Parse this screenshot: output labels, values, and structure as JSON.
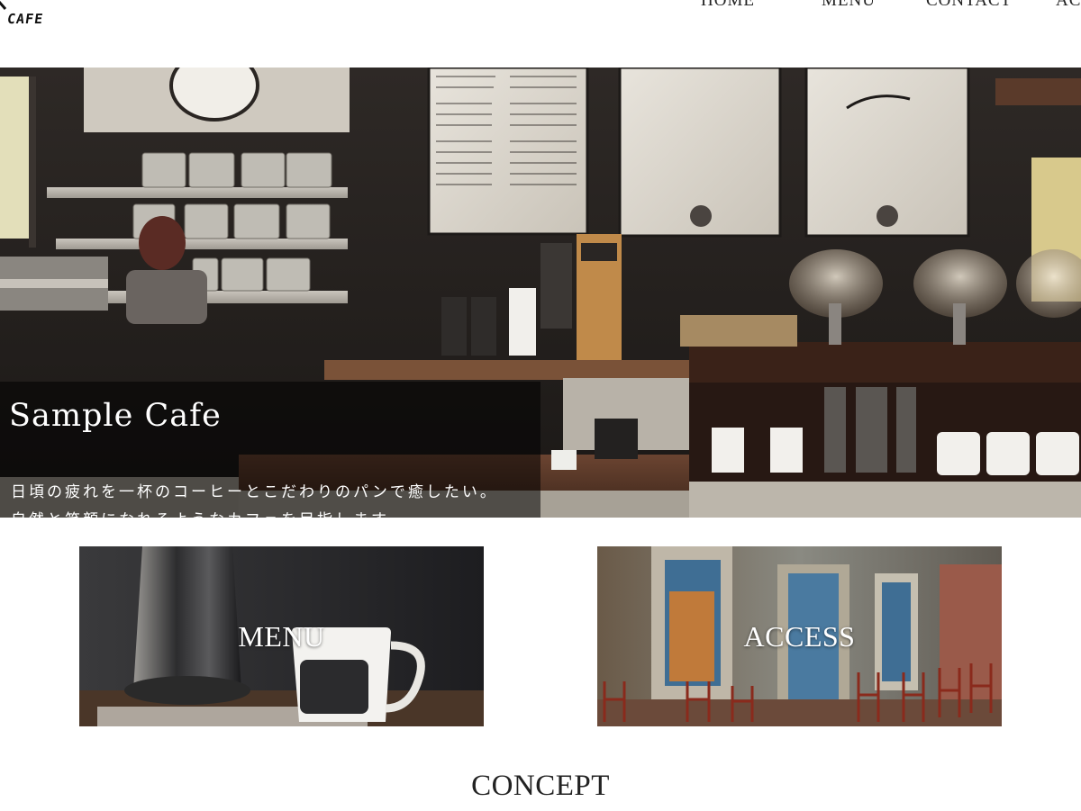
{
  "logo": {
    "text": "E CAFE",
    "icon": "pen-icon"
  },
  "nav": {
    "home": "HOME",
    "menu": "MENU",
    "contact": "CONTACT",
    "access": "AC"
  },
  "hero": {
    "title": "Sample Cafe",
    "line1": "日頃の疲れを一杯のコーヒーとこだわりのパンで癒したい。",
    "line2": "自然と笑顔になれるようなカフェを目指します。"
  },
  "cards": {
    "menu": "MENU",
    "access": "ACCESS"
  },
  "section": {
    "concept": "CONCEPT"
  }
}
